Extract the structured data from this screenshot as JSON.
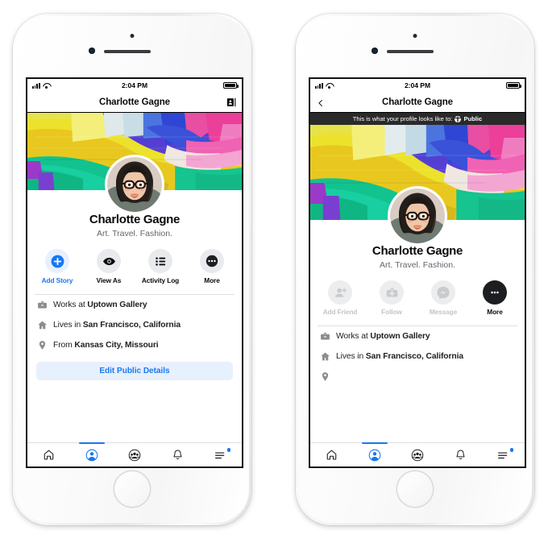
{
  "meta": {
    "brand_blue": "#1877F2",
    "light_blue_bg": "#E7F0FD",
    "grey_bg": "#E9EAED",
    "dark": "#1C1E21",
    "muted_text": "#62666D",
    "disabled_text": "#C3C5C9"
  },
  "phone_left": {
    "status_bar": {
      "time": "2:04 PM",
      "signal_icon": "cellular-bars-icon",
      "wifi_icon": "wifi-icon",
      "battery_icon": "battery-full-icon"
    },
    "header": {
      "title": "Charlotte Gagne",
      "right_icon": "contact-card-icon"
    },
    "profile": {
      "name": "Charlotte Gagne",
      "tagline": "Art. Travel. Fashion.",
      "cover_photo_alt": "abstract-paint-cover",
      "avatar_alt": "profile-photo"
    },
    "actions": [
      {
        "label": "Add Story",
        "icon": "plus-circle-icon",
        "style": "blue",
        "enabled": true
      },
      {
        "label": "View As",
        "icon": "eye-icon",
        "style": "grey",
        "enabled": true
      },
      {
        "label": "Activity Log",
        "icon": "list-icon",
        "style": "grey",
        "enabled": true
      },
      {
        "label": "More",
        "icon": "dots-icon",
        "style": "grey",
        "enabled": true
      }
    ],
    "info_rows": [
      {
        "icon": "briefcase-icon",
        "prefix": "Works at ",
        "value": "Uptown Gallery"
      },
      {
        "icon": "home-icon",
        "prefix": "Lives in ",
        "value": "San Francisco, California"
      },
      {
        "icon": "location-pin-icon",
        "prefix": "From ",
        "value": "Kansas City, Missouri"
      }
    ],
    "edit_button": {
      "label": "Edit Public Details"
    },
    "tabbar": [
      {
        "name": "home-tab",
        "icon": "home-icon",
        "active": false
      },
      {
        "name": "profile-tab",
        "icon": "person-circle-icon",
        "active": true
      },
      {
        "name": "groups-tab",
        "icon": "people-circle-icon",
        "active": false
      },
      {
        "name": "notifications-tab",
        "icon": "bell-icon",
        "active": false
      },
      {
        "name": "menu-tab",
        "icon": "hamburger-menu-icon",
        "active": false,
        "badge": true
      }
    ]
  },
  "phone_right": {
    "status_bar": {
      "time": "2:04 PM",
      "signal_icon": "cellular-bars-icon",
      "wifi_icon": "wifi-icon",
      "battery_icon": "battery-full-icon"
    },
    "header": {
      "title": "Charlotte Gagne",
      "left_icon": "back-chevron-icon"
    },
    "view_as_banner": {
      "text": "This is what your profile looks like to:",
      "audience": "Public",
      "icon": "globe-icon"
    },
    "profile": {
      "name": "Charlotte Gagne",
      "tagline": "Art. Travel. Fashion.",
      "cover_photo_alt": "abstract-paint-cover",
      "avatar_alt": "profile-photo"
    },
    "actions": [
      {
        "label": "Add Friend",
        "icon": "person-plus-icon",
        "style": "disabled",
        "enabled": false
      },
      {
        "label": "Follow",
        "icon": "follow-plus-icon",
        "style": "disabled",
        "enabled": false
      },
      {
        "label": "Message",
        "icon": "messenger-icon",
        "style": "disabled",
        "enabled": false
      },
      {
        "label": "More",
        "icon": "dots-icon",
        "style": "dark",
        "enabled": true
      }
    ],
    "info_rows": [
      {
        "icon": "briefcase-icon",
        "prefix": "Works at ",
        "value": "Uptown Gallery"
      },
      {
        "icon": "home-icon",
        "prefix": "Lives in ",
        "value": "San Francisco, California"
      }
    ],
    "tabbar": [
      {
        "name": "home-tab",
        "icon": "home-icon",
        "active": false
      },
      {
        "name": "profile-tab",
        "icon": "person-circle-icon",
        "active": true
      },
      {
        "name": "groups-tab",
        "icon": "people-circle-icon",
        "active": false
      },
      {
        "name": "notifications-tab",
        "icon": "bell-icon",
        "active": false
      },
      {
        "name": "menu-tab",
        "icon": "hamburger-menu-icon",
        "active": false,
        "badge": true
      }
    ]
  }
}
